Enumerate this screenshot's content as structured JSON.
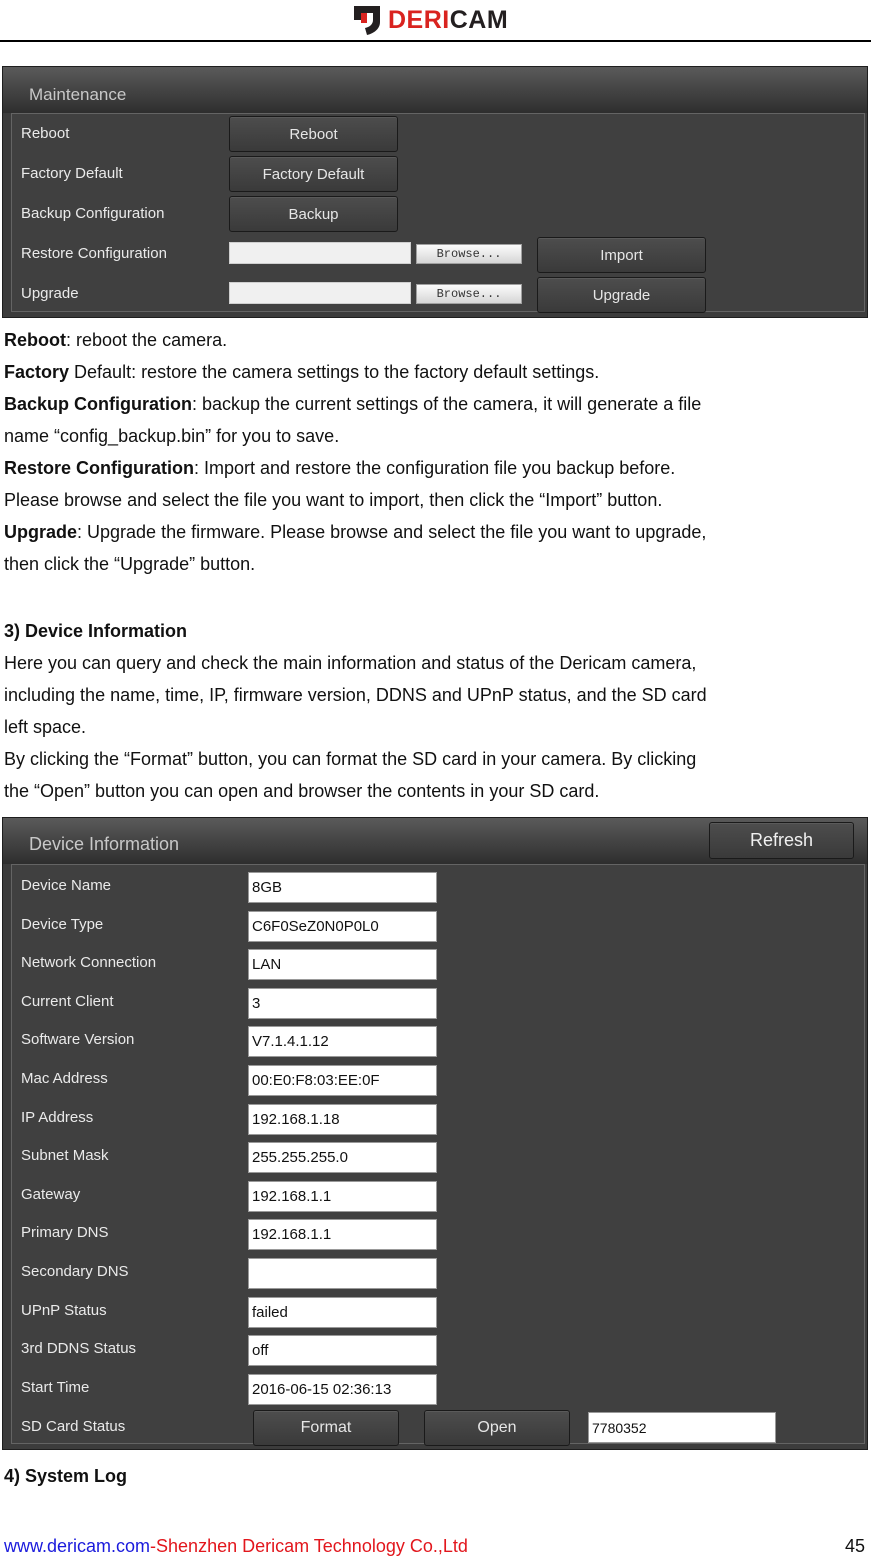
{
  "header": {
    "logo_red": "DERI",
    "logo_dark": "CAM",
    "brand_color": "#d9231f"
  },
  "maintenance_panel": {
    "title": "Maintenance",
    "rows": [
      {
        "label": "Reboot",
        "button": "Reboot"
      },
      {
        "label": "Factory Default",
        "button": "Factory Default"
      },
      {
        "label": "Backup Configuration",
        "button": "Backup"
      },
      {
        "label": "Restore Configuration",
        "file_value": "",
        "browse": "Browse...",
        "button": "Import"
      },
      {
        "label": "Upgrade",
        "file_value": "",
        "browse": "Browse...",
        "button": "Upgrade"
      }
    ]
  },
  "maintenance_desc": [
    {
      "bold": "Reboot",
      "text": ": reboot the camera."
    },
    {
      "bold": "Factory",
      "text": " Default: restore the camera settings to the factory default settings."
    },
    {
      "bold": "Backup Configuration",
      "text": ": backup the current settings of the camera, it will generate a file"
    },
    {
      "bold": "",
      "text": "name “config_backup.bin” for you to save."
    },
    {
      "bold": "Restore Configuration",
      "text": ": Import and restore the configuration file you backup before."
    },
    {
      "bold": "",
      "text": "Please browse and select the file you want to import, then click the “Import” button."
    },
    {
      "bold": "Upgrade",
      "text": ": Upgrade the firmware. Please browse and select the file you want to upgrade,"
    },
    {
      "bold": "",
      "text": "then click the “Upgrade” button."
    }
  ],
  "device_section": {
    "heading": "3) Device Information",
    "paragraphs": [
      "Here you can query and check the main information and status of the Dericam camera,",
      "including the name, time, IP, firmware version, DDNS and UPnP status, and the SD card",
      "left space.",
      "By clicking the “Format” button, you can format the SD card in your camera. By clicking",
      "the “Open” button you can open and browser the contents in your SD card."
    ]
  },
  "device_panel": {
    "title": "Device Information",
    "refresh_button": "Refresh",
    "fields": [
      {
        "label": "Device Name",
        "value": "8GB"
      },
      {
        "label": "Device Type",
        "value": "C6F0SeZ0N0P0L0"
      },
      {
        "label": "Network Connection",
        "value": "LAN"
      },
      {
        "label": "Current Client",
        "value": "3"
      },
      {
        "label": "Software Version",
        "value": "V7.1.4.1.12"
      },
      {
        "label": "Mac Address",
        "value": "00:E0:F8:03:EE:0F"
      },
      {
        "label": "IP Address",
        "value": "192.168.1.18"
      },
      {
        "label": "Subnet Mask",
        "value": "255.255.255.0"
      },
      {
        "label": "Gateway",
        "value": "192.168.1.1"
      },
      {
        "label": "Primary DNS",
        "value": "192.168.1.1"
      },
      {
        "label": "Secondary DNS",
        "value": ""
      },
      {
        "label": "UPnP Status",
        "value": "failed"
      },
      {
        "label": "3rd DDNS Status",
        "value": "off"
      },
      {
        "label": "Start Time",
        "value": "2016-06-15 02:36:13"
      }
    ],
    "sd_card": {
      "label": "SD Card Status",
      "format_button": "Format",
      "open_button": "Open",
      "value": "7780352"
    }
  },
  "next_heading": "4) System Log",
  "footer": {
    "url": "www.dericam.com",
    "company": "-Shenzhen Dericam Technology Co.,Ltd",
    "page_number": "45",
    "url_color": "#1a1adc",
    "company_color": "#e2161c"
  }
}
